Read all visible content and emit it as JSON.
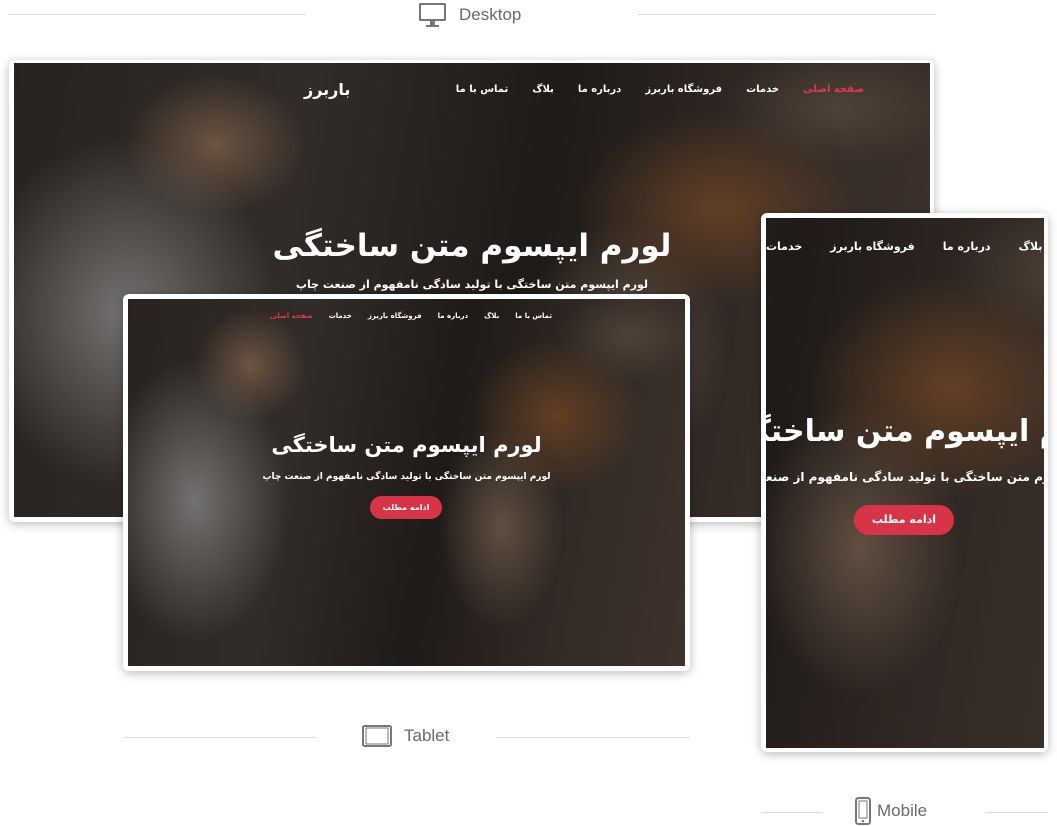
{
  "labels": {
    "desktop": "Desktop",
    "tablet": "Tablet",
    "mobile": "Mobile"
  },
  "site": {
    "brand": "باربرز",
    "nav": [
      "صفحه اصلی",
      "خدمات",
      "فروشگاه باربرز",
      "درباره ما",
      "بلاگ",
      "تماس با ما"
    ],
    "hero_title": "لورم ایپسوم متن ساختگی",
    "hero_subtitle": "لورم ایپسوم متن ساختگی با تولید سادگی نامفهوم از صنعت چاپ",
    "cta": "ادامه مطلب"
  },
  "mobile_nav": [
    "خدمات",
    "فروشگاه باربرز",
    "درباره ما",
    "بلاگ"
  ],
  "colors": {
    "accent": "#d83448",
    "active_nav": "#e0394f"
  },
  "icons": {
    "desktop": "monitor-icon",
    "tablet": "tablet-icon",
    "mobile": "phone-icon"
  }
}
